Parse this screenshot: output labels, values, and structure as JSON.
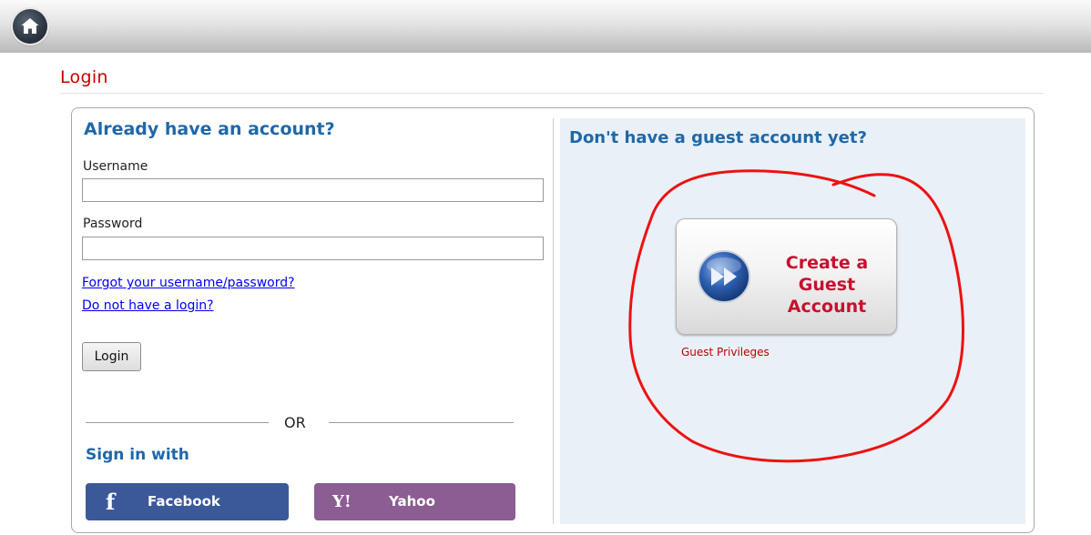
{
  "header": {
    "home_icon": "home-icon"
  },
  "page": {
    "title": "Login"
  },
  "login": {
    "heading": "Already have an account?",
    "username_label": "Username",
    "username_value": "",
    "password_label": "Password",
    "password_value": "",
    "forgot_link": "Forgot your username/password?",
    "no_login_link": "Do not have a login?",
    "login_button": "Login",
    "or_text": "OR",
    "sign_in_with": "Sign in with",
    "facebook_label": "Facebook",
    "yahoo_label": "Yahoo"
  },
  "guest": {
    "heading": "Don't have a guest account yet?",
    "create_line1": "Create a",
    "create_line2": "Guest",
    "create_line3": "Account",
    "privileges_link": "Guest Privileges"
  },
  "colors": {
    "title_red": "#cc0000",
    "heading_blue": "#1f68a8",
    "facebook": "#3b5998",
    "yahoo": "#8b5d93",
    "annotation_red": "#ee1111",
    "guest_panel_bg": "#e9f0f7"
  }
}
